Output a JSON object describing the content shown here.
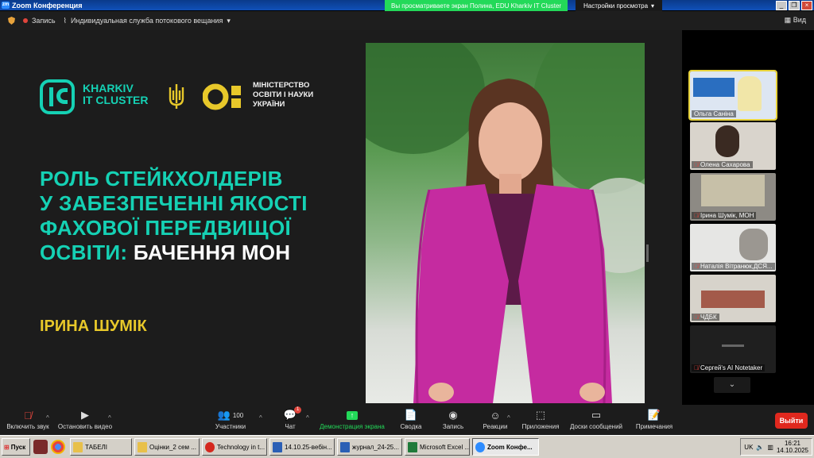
{
  "window": {
    "title": "Zoom Конференция"
  },
  "share_banner": {
    "text": "Вы просматриваете экран Полина, EDU Kharkiv IT Cluster",
    "view_options": "Настройки просмотра"
  },
  "top_toolbar": {
    "record_label": "Запись",
    "stream_label": "Индивидуальная служба потокового вещания",
    "view_label": "Вид"
  },
  "slide": {
    "kic_line1": "KHARKIV",
    "kic_line2": "IT CLUSTER",
    "mon_line1": "МІНІСТЕРСТВО",
    "mon_line2": "ОСВІТИ І НАУКИ",
    "mon_line3": "УКРАЇНИ",
    "headline_1": "РОЛЬ СТЕЙКХОЛДЕРІВ",
    "headline_2": "У ЗАБЕЗПЕЧЕННІ ЯКОСТІ",
    "headline_3": "ФАХОВОЇ ПЕРЕДВИЩОЇ",
    "headline_4a": "ОСВІТИ:",
    "headline_4b": "БАЧЕННЯ МОН",
    "speaker": "ІРИНА ШУМІК",
    "accent_color": "#15d1b4",
    "speaker_color": "#e8c82a"
  },
  "participants": [
    {
      "name": "Ольга Саніна",
      "muted": false,
      "active": true
    },
    {
      "name": "Олена Сахарова",
      "muted": true
    },
    {
      "name": "Ірина Шумік, МОН",
      "muted": true
    },
    {
      "name": "Наталія Вітранюк,ДСЯ...",
      "muted": true
    },
    {
      "name": "ЧДБК",
      "muted": true
    },
    {
      "name": "Сергей's AI Notetaker",
      "muted": true
    }
  ],
  "bottom_toolbar": {
    "audio": "Включить звук",
    "video": "Остановить видео",
    "participants": "Участники",
    "participants_count": "100",
    "chat": "Чат",
    "chat_badge": "1",
    "share": "Демонстрация экрана",
    "summary": "Сводка",
    "record": "Запись",
    "reactions": "Реакции",
    "apps": "Приложения",
    "whiteboards": "Доски сообщений",
    "notes": "Примечания",
    "leave": "Выйти"
  },
  "taskbar": {
    "start": "Пуск",
    "tasks": [
      "ТАБЕЛІ",
      "Оцінки_2 сем ...",
      "Technology in t...",
      "14.10.25-вебін...",
      "журнал_24-25...",
      "Microsoft Excel ...",
      "Zoom Конфе..."
    ],
    "lang": "UK",
    "time": "16:21",
    "date": "14.10.2025"
  }
}
